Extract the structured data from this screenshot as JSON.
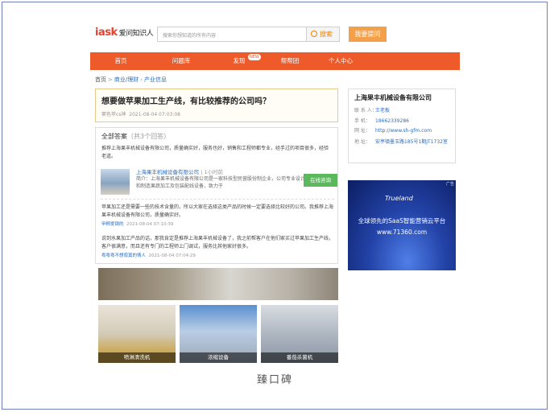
{
  "header": {
    "logo_text": "iask",
    "logo_cn": "爱问知识人",
    "search_placeholder": "搜索你想知道的所有内容",
    "search_label": "搜索",
    "ask_label": "我要提问"
  },
  "nav": {
    "items": [
      "首页",
      "问题库",
      "发现",
      "帮帮团",
      "个人中心"
    ],
    "new_badge": "NEW"
  },
  "breadcrumb": [
    "首页",
    "商业/理财",
    "产业信息"
  ],
  "question": {
    "title": "想要做苹果加工生产线，有比较推荐的公司吗？",
    "user": "窦色苹cs神",
    "time": "2021-08-04 07:03:08"
  },
  "answers": {
    "header": "全部答案",
    "count": "（共3个回答）",
    "a1_text": "推荐上海果丰机械设备有限公司，质量确实好，服务也好，销售和工程师都专业，经手过的项目很多，经验老道。",
    "card": {
      "name": "上海果丰机械设备有限公司",
      "time": "1小时前",
      "desc": "简介：上海果丰机械设备有限公司是一家科技型民营股份制企业，公司专业设计和制造果蔬加工及包装配线设备，致力于",
      "consult_label": "在线咨询"
    },
    "a2_text": "苹果加工还是需要一些的技术含量的，所以大家在选择这类产品的时候一定要选择比较好的公司。我推荐上海果丰机械设备有限公司，质量确实好。",
    "a2_user": "甲桐爱钢的",
    "a2_time": "2021-08-04 07:10:39",
    "a3_text": "说到水果加工产品的话，那我肯定是推荐上海果丰机械设备了，我之前帮客户在他们家买过苹果加工生产线，客户很满意，而且还有专门的工程师上门调试，服务比其他家好很多。",
    "a3_user": "粤粤粤不想寂寞的情人",
    "a3_time": "2021-08-04 07:04:29"
  },
  "thumbs": [
    "喷淋清洗机",
    "浓缩设备",
    "番茄杀菌机"
  ],
  "sidebar": {
    "company": "上海果丰机械设备有限公司",
    "rows": [
      {
        "k": "联 系 人：",
        "v": "王老板"
      },
      {
        "k": "手  机：",
        "v": "18662339286"
      },
      {
        "k": "网  址：",
        "v": "http://www.sh-gfm.com"
      },
      {
        "k": "地  址：",
        "v": "安亭镇墨玉路185号1期JT1732室"
      }
    ]
  },
  "ad": {
    "tag": "广告",
    "brand": "Trueland",
    "line1": "全球领先的SaaS智能营销云平台",
    "line2": "www.71360.com"
  },
  "caption": "臻口碑",
  "colors": {
    "brand_orange": "#ef5a2a",
    "link_blue": "#2b6fbf",
    "consult_green": "#5bb85d"
  }
}
